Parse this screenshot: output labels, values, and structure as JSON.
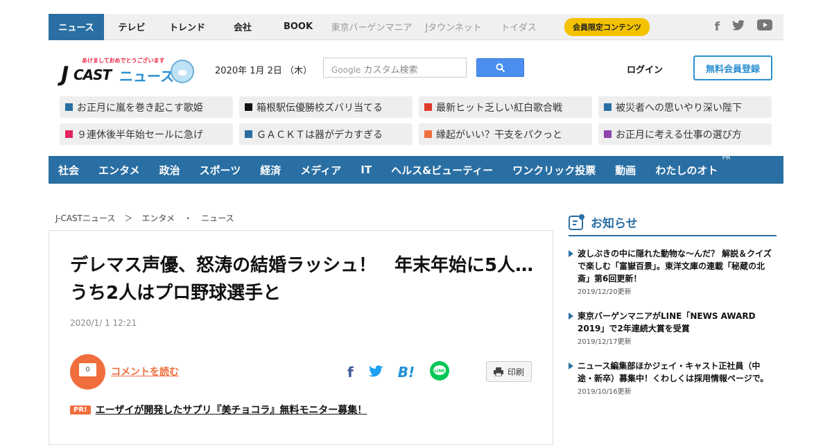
{
  "topnav": {
    "tabs": [
      "ニュース",
      "テレビ",
      "トレンド",
      "会社",
      "BOOK"
    ],
    "grey_tabs": [
      "東京バーゲンマニア",
      "Jタウンネット",
      "トイダス"
    ],
    "member": "会員限定コンテンツ"
  },
  "logo": {
    "tagline": "あけましておめでとうございます",
    "j": "J",
    "cast": "CAST",
    "news": "ニュース"
  },
  "header": {
    "date": "2020年 1月 2日 （木）",
    "search_placeholder": "カスタム検索",
    "search_brand": "Google",
    "login": "ログイン",
    "register": "無料会員登録"
  },
  "trends": [
    {
      "label": "お正月に嵐を巻き起こす歌姫",
      "color": "#2a6fa3"
    },
    {
      "label": "箱根駅伝優勝校ズバリ当てる",
      "color": "#111111"
    },
    {
      "label": "最新ヒット乏しい紅白歌合戦",
      "color": "#e03a2a"
    },
    {
      "label": "被災者への思いやり深い陛下",
      "color": "#2a6fa3"
    },
    {
      "label": "９連休後半年始セールに急げ",
      "color": "#e0245e"
    },
    {
      "label": "ＧＡＣＫＴは器がデカすぎる",
      "color": "#2a6fa3"
    },
    {
      "label": "縁起がいい？干支をパクっと",
      "color": "#f06d3c"
    },
    {
      "label": "お正月に考える仕事の選び方",
      "color": "#8e44ad"
    }
  ],
  "categories": [
    "社会",
    "エンタメ",
    "政治",
    "スポーツ",
    "経済",
    "メディア",
    "IT",
    "ヘルス&ビューティー",
    "ワンクリック投票",
    "動画",
    "わたしのオト"
  ],
  "pr_mark": "PR",
  "breadcrumb": [
    "J-CASTニュース",
    "＞",
    "エンタメ",
    "・",
    "ニュース"
  ],
  "article": {
    "title": "デレマス声優、怒涛の結婚ラッシュ！　年末年始に5人…うち2人はプロ野球選手と",
    "date": "2020/1/ 1 12:21",
    "comment_count": "0",
    "comment_link": "コメントを読む",
    "print": "印刷",
    "pr_badge": "PR!",
    "pr_link": "エーザイが開発したサプリ『美チョコラ』無料モニター募集！"
  },
  "sidebar": {
    "title": "お知らせ",
    "notices": [
      {
        "text": "波しぶきの中に隠れた動物な～んだ？ 解説＆クイズで楽しむ「富嶽百景」。東洋文庫の連載「秘蔵の北斎」第6回更新！",
        "date": "2019/12/20更新"
      },
      {
        "text": "東京バーゲンマニアがLINE「NEWS AWARD 2019」で2年連続大賞を受賞",
        "date": "2019/12/17更新"
      },
      {
        "text": "ニュース編集部ほかジェイ・キャスト正社員（中途・新卒）募集中！くわしくは採用情報ページで。",
        "date": "2019/10/16更新"
      }
    ]
  }
}
